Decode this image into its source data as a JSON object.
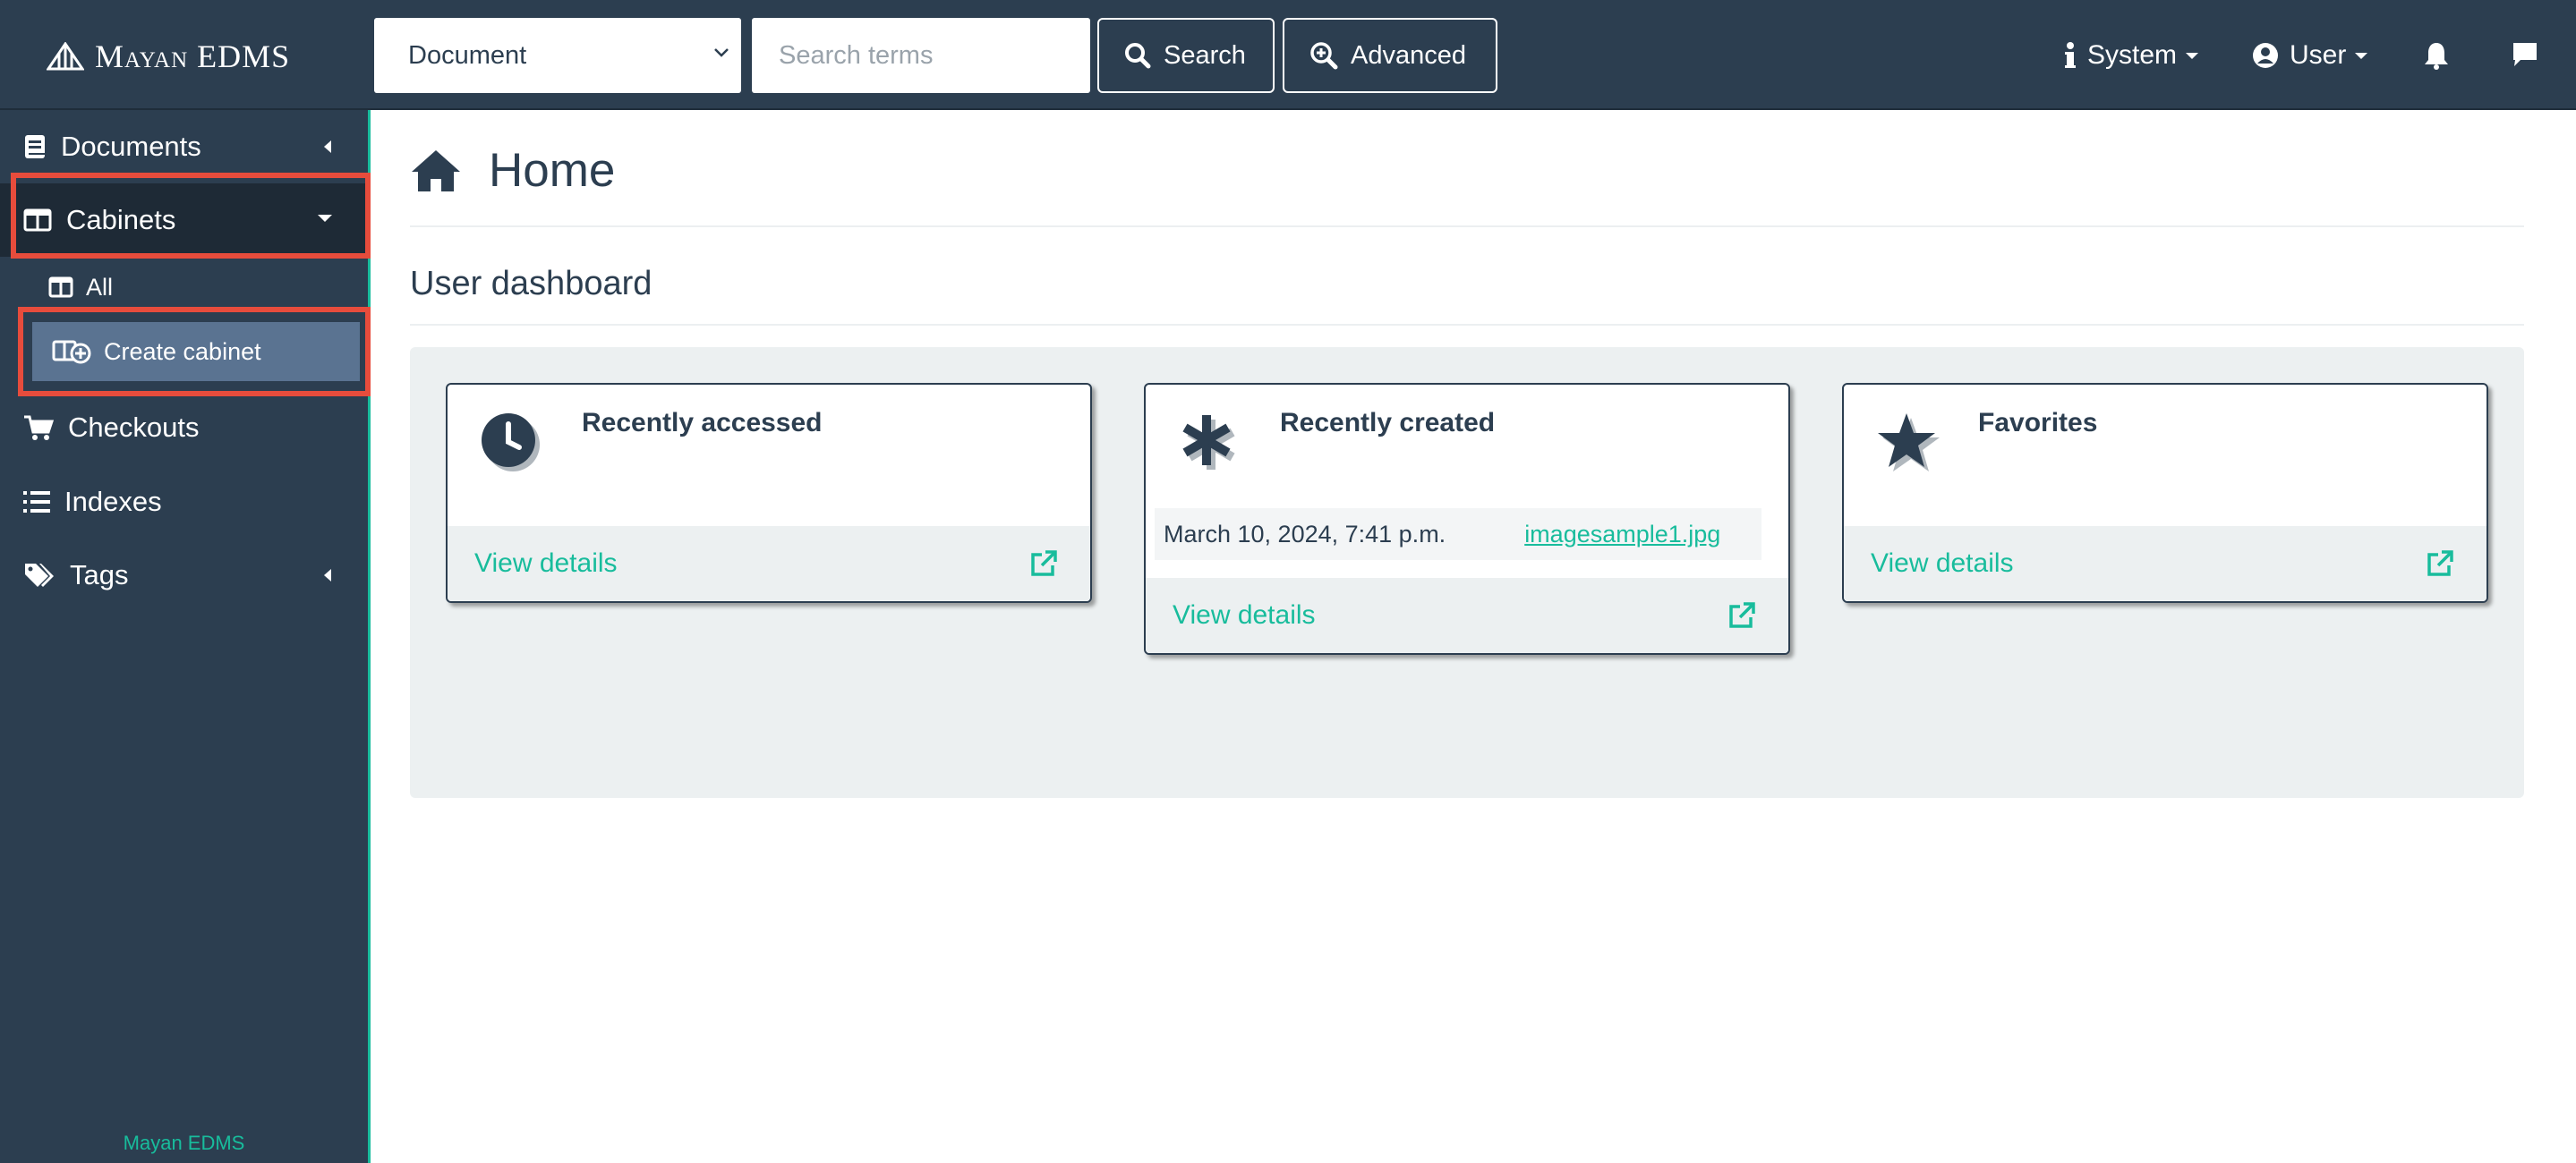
{
  "navbar": {
    "brand": "Mayan EDMS",
    "search_type": "Document",
    "search_placeholder": "Search terms",
    "search_label": "Search",
    "advanced_label": "Advanced",
    "system_label": "System",
    "user_label": "User"
  },
  "sidebar": {
    "items": [
      {
        "label": "Documents"
      },
      {
        "label": "Cabinets"
      },
      {
        "label": "Checkouts"
      },
      {
        "label": "Indexes"
      },
      {
        "label": "Tags"
      }
    ],
    "cabinets_sub": [
      {
        "label": "All"
      },
      {
        "label": "Create cabinet"
      }
    ],
    "footer": "Mayan EDMS"
  },
  "main": {
    "title": "Home",
    "section_title": "User dashboard",
    "cards": [
      {
        "title": "Recently accessed",
        "footer": "View details"
      },
      {
        "title": "Recently created",
        "footer": "View details",
        "row_date": "March 10, 2024, 7:41 p.m.",
        "row_link": "imagesample1.jpg"
      },
      {
        "title": "Favorites",
        "footer": "View details"
      }
    ]
  },
  "colors": {
    "navbar_bg": "#2c3e50",
    "accent": "#18bc9c",
    "highlight": "#e74c3c",
    "selected_item": "#5a7391"
  }
}
